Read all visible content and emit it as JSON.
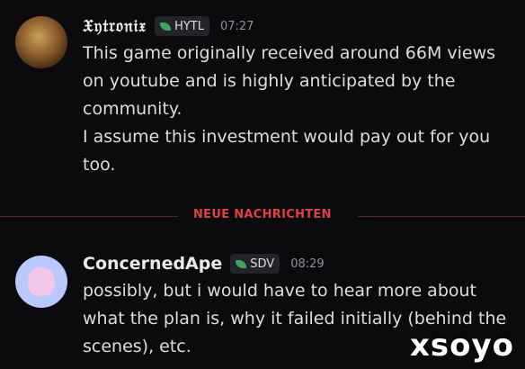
{
  "messages": [
    {
      "username": "𝔛𝔶𝔱𝔯𝔬𝔫𝔦𝔵",
      "tag": "HYTL",
      "time": "07:27",
      "lines": [
        "This game originally received around 66M views on youtube and is highly anticipated by the community.",
        "I assume this investment would pay out for you too."
      ],
      "avatar_icon": "avatar-anime-character"
    },
    {
      "username": "ConcernedApe",
      "tag": "SDV",
      "time": "08:29",
      "lines": [
        "possibly, but i would have to hear more about what the plan is, why it failed initially (behind the scenes), etc."
      ],
      "avatar_icon": "avatar-pink-creature"
    }
  ],
  "divider": {
    "label": "NEUE NACHRICHTEN",
    "color": "#e0413f"
  },
  "watermark": "xsoyo",
  "colors": {
    "background": "#0b0b0d",
    "text": "#dcddde",
    "tag_leaf": "#3ba55c"
  }
}
